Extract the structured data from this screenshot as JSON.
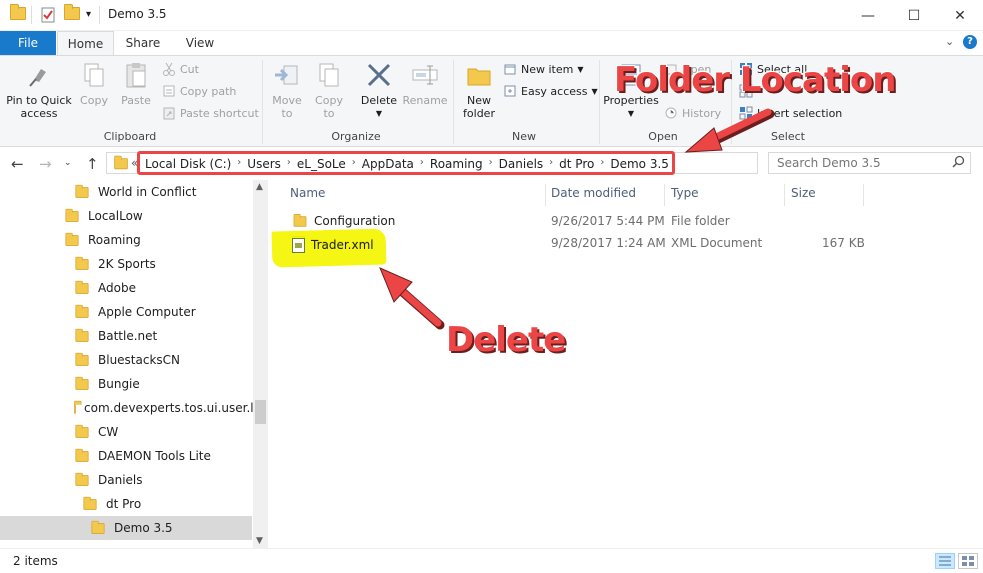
{
  "window": {
    "title": "Demo 3.5",
    "minimize": "—",
    "maximize": "☐",
    "close": "✕"
  },
  "ribbon_tabs": {
    "file": "File",
    "home": "Home",
    "share": "Share",
    "view": "View"
  },
  "ribbon": {
    "clipboard": {
      "label": "Clipboard",
      "pin_line1": "Pin to Quick",
      "pin_line2": "access",
      "copy": "Copy",
      "paste": "Paste",
      "cut": "Cut",
      "copy_path": "Copy path",
      "paste_shortcut": "Paste shortcut"
    },
    "organize": {
      "label": "Organize",
      "move_line1": "Move",
      "move_line2": "to",
      "copy_line1": "Copy",
      "copy_line2": "to",
      "delete": "Delete",
      "rename": "Rename"
    },
    "new": {
      "label": "New",
      "new_folder_line1": "New",
      "new_folder_line2": "folder",
      "new_item": "New item",
      "easy_access": "Easy access"
    },
    "open": {
      "label": "Open",
      "properties": "Properties",
      "open": "Open",
      "history": "History"
    },
    "select": {
      "label": "Select",
      "select_all": "Select all",
      "invert_selection": "Invert selection"
    }
  },
  "address": {
    "overflow": "«",
    "crumbs": [
      "Local Disk (C:)",
      "Users",
      "eL_SoLe",
      "AppData",
      "Roaming",
      "Daniels",
      "dt Pro",
      "Demo 3.5"
    ],
    "separator": "›",
    "search_placeholder": "Search Demo 3.5"
  },
  "nav_items": [
    {
      "label": "World in Conflict",
      "indent": 1
    },
    {
      "label": "LocalLow",
      "indent": 0
    },
    {
      "label": "Roaming",
      "indent": 0
    },
    {
      "label": "2K Sports",
      "indent": 1
    },
    {
      "label": "Adobe",
      "indent": 1
    },
    {
      "label": "Apple Computer",
      "indent": 1
    },
    {
      "label": "Battle.net",
      "indent": 1
    },
    {
      "label": "BluestacksCN",
      "indent": 1
    },
    {
      "label": "Bungie",
      "indent": 1
    },
    {
      "label": "com.devexperts.tos.ui.user.log",
      "indent": 1
    },
    {
      "label": "CW",
      "indent": 1
    },
    {
      "label": "DAEMON Tools Lite",
      "indent": 1
    },
    {
      "label": "Daniels",
      "indent": 1
    },
    {
      "label": "dt Pro",
      "indent": 2
    },
    {
      "label": "Demo 3.5",
      "indent": 3,
      "selected": true
    }
  ],
  "columns": {
    "name": "Name",
    "date": "Date modified",
    "type": "Type",
    "size": "Size"
  },
  "files": [
    {
      "name": "Configuration",
      "date": "9/26/2017 5:44 PM",
      "type": "File folder",
      "size": "",
      "icon": "folder-icon"
    },
    {
      "name": "Trader.xml",
      "date": "9/28/2017 1:24 AM",
      "type": "XML Document",
      "size": "167 KB",
      "icon": "xml-file-icon"
    }
  ],
  "status": {
    "item_count": "2 items"
  },
  "annotations": {
    "folder_location": "Folder Location",
    "delete": "Delete",
    "accent_color": "#ec4545",
    "highlight_color": "#f5f500"
  }
}
